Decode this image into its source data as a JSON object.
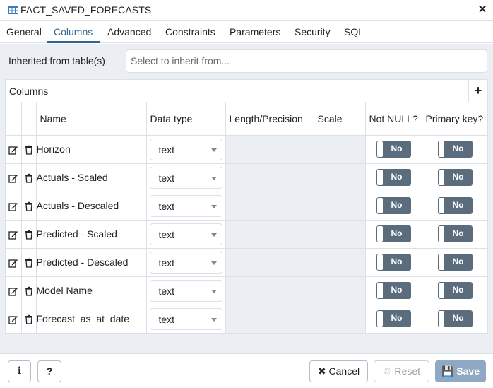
{
  "dialog": {
    "title": "FACT_SAVED_FORECASTS",
    "close_glyph": "✕"
  },
  "tabs": [
    {
      "label": "General"
    },
    {
      "label": "Columns",
      "active": true
    },
    {
      "label": "Advanced"
    },
    {
      "label": "Constraints"
    },
    {
      "label": "Parameters"
    },
    {
      "label": "Security"
    },
    {
      "label": "SQL"
    }
  ],
  "inherit": {
    "label": "Inherited from table(s)",
    "placeholder": "Select to inherit from..."
  },
  "columns_panel": {
    "title": "Columns",
    "add_glyph": "+",
    "headers": {
      "name": "Name",
      "data_type": "Data type",
      "length": "Length/Precision",
      "scale": "Scale",
      "not_null": "Not NULL?",
      "primary_key": "Primary key?"
    },
    "rows": [
      {
        "name": "Horizon",
        "data_type": "text",
        "not_null": "No",
        "primary_key": "No"
      },
      {
        "name": "Actuals - Scaled",
        "data_type": "text",
        "not_null": "No",
        "primary_key": "No"
      },
      {
        "name": "Actuals - Descaled",
        "data_type": "text",
        "not_null": "No",
        "primary_key": "No"
      },
      {
        "name": "Predicted - Scaled",
        "data_type": "text",
        "not_null": "No",
        "primary_key": "No"
      },
      {
        "name": "Predicted - Descaled",
        "data_type": "text",
        "not_null": "No",
        "primary_key": "No"
      },
      {
        "name": "Model Name",
        "data_type": "text",
        "not_null": "No",
        "primary_key": "No"
      },
      {
        "name": "Forecast_as_at_date",
        "data_type": "text",
        "not_null": "No",
        "primary_key": "No"
      }
    ]
  },
  "footer": {
    "info_label": "i",
    "help_label": "?",
    "cancel_label": "✖ Cancel",
    "reset_label": "♲ Reset",
    "save_label": "💾 Save"
  },
  "colors": {
    "accent": "#326690",
    "toggle_off": "#5b6d7c",
    "save_disabled": "#8fa8c3",
    "panel_bg": "#ebeef3"
  }
}
